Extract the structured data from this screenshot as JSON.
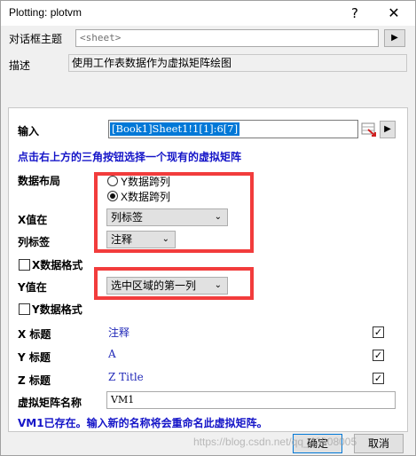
{
  "window": {
    "title": "Plotting: plotvm",
    "help_glyph": "?",
    "close_glyph": "✕"
  },
  "header": {
    "theme_label": "对话框主题",
    "theme_value": "<sheet>",
    "theme_button_glyph": "▶",
    "desc_label": "描述",
    "desc_value": "使用工作表数据作为虚拟矩阵绘图"
  },
  "form": {
    "input_label": "输入",
    "input_value": "[Book1]Sheet1!1[1]:6[7]",
    "input_next_glyph": "▶",
    "hint": "点击右上方的三角按钮选择一个现有的虚拟矩阵",
    "layout_label": "数据布局",
    "layout_options": [
      "Y数据跨列",
      "X数据跨列"
    ],
    "layout_selected": "X数据跨列",
    "x_value_label": "X值在",
    "x_value_selected": "列标签",
    "col_label_label": "列标签",
    "col_label_selected": "注释",
    "x_format_label": "X数据格式",
    "y_value_label": "Y值在",
    "y_value_selected": "选中区域的第一列",
    "y_format_label": "Y数据格式",
    "x_title_label": "X 标题",
    "x_title_value": "注释",
    "y_title_label": "Y 标题",
    "y_title_value": "A",
    "z_title_label": "Z 标题",
    "z_title_value": "Z Title",
    "vm_name_label": "虚拟矩阵名称",
    "vm_name_value": "VM1",
    "vm_notice": "VM1已存在。输入新的名称将会重命名此虚拟矩阵。"
  },
  "footer": {
    "ok_label": "确定",
    "cancel_label": "取消",
    "watermark": "https://blog.csdn.net/qq_42908005"
  },
  "colors": {
    "highlight_red": "#f23c3c",
    "hint_blue": "#1515c8",
    "selection_blue": "#0078d7"
  }
}
